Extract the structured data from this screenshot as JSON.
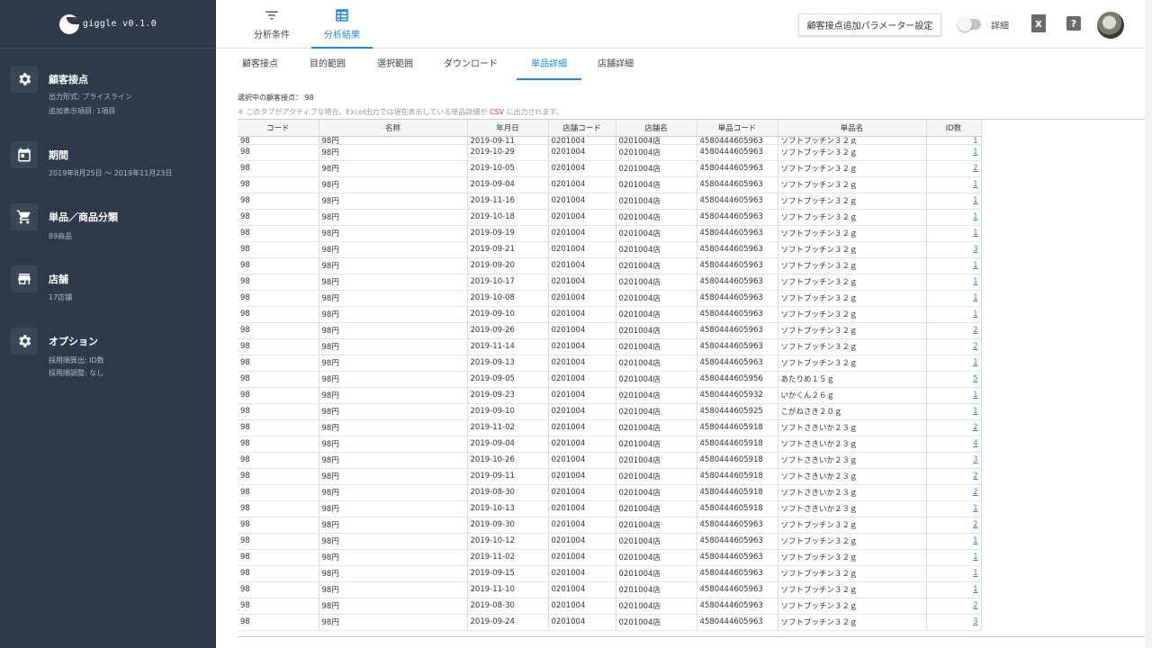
{
  "app": {
    "logo_text": "giggle v0.1.0"
  },
  "sidebar": {
    "sections": [
      {
        "title": "顧客接点",
        "icon": "gear-icon",
        "lines": [
          "出力形式: プライスライン",
          "追加表示項目: 1項目"
        ]
      },
      {
        "title": "期間",
        "icon": "calendar-icon",
        "lines": [
          "2019年8月25日 〜 2019年11月23日"
        ]
      },
      {
        "title": "単品／商品分類",
        "icon": "cart-icon",
        "lines": [
          "89商品"
        ]
      },
      {
        "title": "店舗",
        "icon": "store-icon",
        "lines": [
          "17店舗"
        ]
      },
      {
        "title": "オプション",
        "icon": "gear-icon",
        "lines": [
          "採用順算出: ID数",
          "採用順調整: なし"
        ]
      }
    ]
  },
  "topbar": {
    "tabs": [
      {
        "label": "分析条件",
        "icon": "filter-icon",
        "active": false
      },
      {
        "label": "分析結果",
        "icon": "table-icon",
        "active": true
      }
    ],
    "param_button": "顧客接点追加パラメーター設定",
    "toggle_label": "詳細",
    "toggle_on": false,
    "excel_icon": "excel-icon",
    "help_icon": "help-icon"
  },
  "subtabs": [
    "顧客接点",
    "目的範囲",
    "選択範囲",
    "ダウンロード",
    "単品詳細",
    "店舗詳細"
  ],
  "active_subtab": "単品詳細",
  "selection": {
    "label": "選択中の顧客接点：",
    "value": "98"
  },
  "note": {
    "prefix": "※ このタブがアクティブな場合、Excel出力では現在表示している単品詳細が",
    "csv": "CSV",
    "suffix": "に出力されます。"
  },
  "table": {
    "headers": [
      "コード",
      "名称",
      "年月日",
      "店舗コード",
      "店舗名",
      "単品コード",
      "単品名",
      "ID数"
    ],
    "partial_row": [
      "98",
      "98円",
      "2019-09-11",
      "0201004",
      "0201004店",
      "4580444605963",
      "ソフトプッチン３２ｇ",
      "1"
    ],
    "rows": [
      [
        "98",
        "98円",
        "2019-10-29",
        "0201004",
        "0201004店",
        "4580444605963",
        "ソフトプッチン３２ｇ",
        "1"
      ],
      [
        "98",
        "98円",
        "2019-10-05",
        "0201004",
        "0201004店",
        "4580444605963",
        "ソフトプッチン３２ｇ",
        "2"
      ],
      [
        "98",
        "98円",
        "2019-09-04",
        "0201004",
        "0201004店",
        "4580444605963",
        "ソフトプッチン３２ｇ",
        "1"
      ],
      [
        "98",
        "98円",
        "2019-11-16",
        "0201004",
        "0201004店",
        "4580444605963",
        "ソフトプッチン３２ｇ",
        "1"
      ],
      [
        "98",
        "98円",
        "2019-10-18",
        "0201004",
        "0201004店",
        "4580444605963",
        "ソフトプッチン３２ｇ",
        "1"
      ],
      [
        "98",
        "98円",
        "2019-09-19",
        "0201004",
        "0201004店",
        "4580444605963",
        "ソフトプッチン３２ｇ",
        "1"
      ],
      [
        "98",
        "98円",
        "2019-09-21",
        "0201004",
        "0201004店",
        "4580444605963",
        "ソフトプッチン３２ｇ",
        "3"
      ],
      [
        "98",
        "98円",
        "2019-09-20",
        "0201004",
        "0201004店",
        "4580444605963",
        "ソフトプッチン３２ｇ",
        "1"
      ],
      [
        "98",
        "98円",
        "2019-10-17",
        "0201004",
        "0201004店",
        "4580444605963",
        "ソフトプッチン３２ｇ",
        "1"
      ],
      [
        "98",
        "98円",
        "2019-10-08",
        "0201004",
        "0201004店",
        "4580444605963",
        "ソフトプッチン３２ｇ",
        "1"
      ],
      [
        "98",
        "98円",
        "2019-09-10",
        "0201004",
        "0201004店",
        "4580444605963",
        "ソフトプッチン３２ｇ",
        "1"
      ],
      [
        "98",
        "98円",
        "2019-09-26",
        "0201004",
        "0201004店",
        "4580444605963",
        "ソフトプッチン３２ｇ",
        "2"
      ],
      [
        "98",
        "98円",
        "2019-11-14",
        "0201004",
        "0201004店",
        "4580444605963",
        "ソフトプッチン３２ｇ",
        "2"
      ],
      [
        "98",
        "98円",
        "2019-09-13",
        "0201004",
        "0201004店",
        "4580444605963",
        "ソフトプッチン３２ｇ",
        "1"
      ],
      [
        "98",
        "98円",
        "2019-09-05",
        "0201004",
        "0201004店",
        "4580444605956",
        "あたりめ１５ｇ",
        "5"
      ],
      [
        "98",
        "98円",
        "2019-09-23",
        "0201004",
        "0201004店",
        "4580444605932",
        "いかくん２６ｇ",
        "1"
      ],
      [
        "98",
        "98円",
        "2019-09-10",
        "0201004",
        "0201004店",
        "4580444605925",
        "こがねさき２０ｇ",
        "1"
      ],
      [
        "98",
        "98円",
        "2019-11-02",
        "0201004",
        "0201004店",
        "4580444605918",
        "ソフトさきいか２３ｇ",
        "2"
      ],
      [
        "98",
        "98円",
        "2019-09-04",
        "0201004",
        "0201004店",
        "4580444605918",
        "ソフトさきいか２３ｇ",
        "4"
      ],
      [
        "98",
        "98円",
        "2019-10-26",
        "0201004",
        "0201004店",
        "4580444605918",
        "ソフトさきいか２３ｇ",
        "3"
      ],
      [
        "98",
        "98円",
        "2019-09-11",
        "0201004",
        "0201004店",
        "4580444605918",
        "ソフトさきいか２３ｇ",
        "2"
      ],
      [
        "98",
        "98円",
        "2019-08-30",
        "0201004",
        "0201004店",
        "4580444605918",
        "ソフトさきいか２３ｇ",
        "2"
      ],
      [
        "98",
        "98円",
        "2019-10-13",
        "0201004",
        "0201004店",
        "4580444605918",
        "ソフトさきいか２３ｇ",
        "1"
      ],
      [
        "98",
        "98円",
        "2019-09-30",
        "0201004",
        "0201004店",
        "4580444605963",
        "ソフトプッチン３２ｇ",
        "2"
      ],
      [
        "98",
        "98円",
        "2019-10-12",
        "0201004",
        "0201004店",
        "4580444605963",
        "ソフトプッチン３２ｇ",
        "1"
      ],
      [
        "98",
        "98円",
        "2019-11-02",
        "0201004",
        "0201004店",
        "4580444605963",
        "ソフトプッチン３２ｇ",
        "1"
      ],
      [
        "98",
        "98円",
        "2019-09-15",
        "0201004",
        "0201004店",
        "4580444605963",
        "ソフトプッチン３２ｇ",
        "1"
      ],
      [
        "98",
        "98円",
        "2019-11-10",
        "0201004",
        "0201004店",
        "4580444605963",
        "ソフトプッチン３２ｇ",
        "1"
      ],
      [
        "98",
        "98円",
        "2019-08-30",
        "0201004",
        "0201004店",
        "4580444605963",
        "ソフトプッチン３２ｇ",
        "2"
      ],
      [
        "98",
        "98円",
        "2019-09-24",
        "0201004",
        "0201004店",
        "4580444605963",
        "ソフトプッチン３２ｇ",
        "3"
      ]
    ]
  },
  "colors": {
    "sidebar_bg": "#2e3a47",
    "accent": "#1e88e5",
    "csv_red": "#e53935"
  }
}
